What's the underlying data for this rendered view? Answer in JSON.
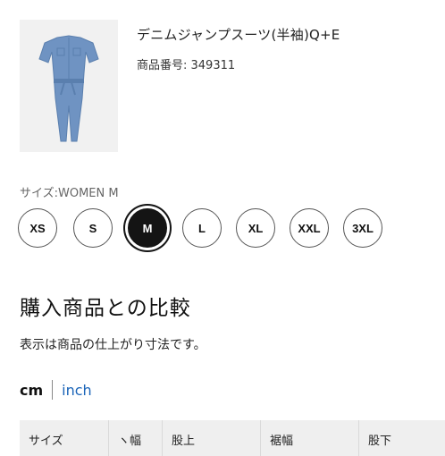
{
  "product": {
    "name": "デニムジャンプスーツ(半袖)Q+E",
    "number": "商品番号: 349311",
    "image_alt": "denim jumpsuit"
  },
  "size": {
    "selected_label": "サイズ:WOMEN M",
    "options": [
      "XS",
      "S",
      "M",
      "L",
      "XL",
      "XXL",
      "3XL"
    ],
    "selected": "M"
  },
  "compare": {
    "title": "購入商品との比較",
    "note": "表示は商品の仕上がり寸法です。"
  },
  "units": {
    "cm": "cm",
    "inch": "inch",
    "active": "cm"
  },
  "table": {
    "headers": [
      "サイズ",
      "ヽ幅",
      "股上",
      "裾幅",
      "股下"
    ]
  },
  "colors": {
    "accent_link": "#1a64b8",
    "selected_size": "#141414",
    "denim": "#6f93c2"
  }
}
